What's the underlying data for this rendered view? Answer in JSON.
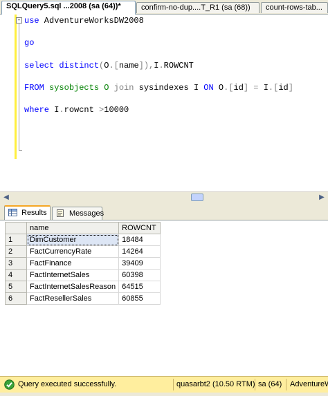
{
  "doc_tabs": [
    {
      "label": "SQLQuery5.sql ...2008 (sa (64))*",
      "active": true
    },
    {
      "label": "confirm-no-dup....T_R1 (sa (68))",
      "active": false
    },
    {
      "label": "count-rows-tab...",
      "active": false
    }
  ],
  "editor": {
    "lines": {
      "use": {
        "kw": "use",
        "rest": " AdventureWorksDW2008"
      },
      "go": {
        "kw": "go"
      },
      "select": {
        "kw1": "select",
        "sp1": " ",
        "kw2": "distinct",
        "p1": "(",
        "c1": "O",
        "p2": ".[",
        "c2": "name",
        "p3": "]),",
        "c3": "I",
        "p4": ".",
        "c4": "ROWCNT"
      },
      "from": {
        "kw1": "FROM",
        "t1": " sysobjects O ",
        "kw2": "join",
        "t2": " sysindexes I ",
        "kw3": "ON",
        "t3": " O",
        "p1": ".[",
        "c1": "id",
        "p2": "]",
        "eq": " = ",
        "c2": "I",
        "p3": ".[",
        "c3": "id",
        "p4": "]"
      },
      "where": {
        "kw": "where",
        "t1": " I",
        "p1": ".",
        "c1": "rowcnt ",
        "gt": ">",
        "c2": "10000"
      }
    },
    "outline_collapse_glyph": "-"
  },
  "results_tabs": [
    {
      "label": "Results",
      "icon": "grid-icon",
      "active": true
    },
    {
      "label": "Messages",
      "icon": "messages-icon",
      "active": false
    }
  ],
  "grid": {
    "columns": [
      "name",
      "ROWCNT"
    ],
    "rows": [
      {
        "n": "1",
        "name": "DimCustomer",
        "rowcnt": "18484"
      },
      {
        "n": "2",
        "name": "FactCurrencyRate",
        "rowcnt": "14264"
      },
      {
        "n": "3",
        "name": "FactFinance",
        "rowcnt": "39409"
      },
      {
        "n": "4",
        "name": "FactInternetSales",
        "rowcnt": "60398"
      },
      {
        "n": "5",
        "name": "FactInternetSalesReason",
        "rowcnt": "64515"
      },
      {
        "n": "6",
        "name": "FactResellerSales",
        "rowcnt": "60855"
      }
    ]
  },
  "status": {
    "message": "Query executed successfully.",
    "server": "quasarbt2 (10.50 RTM)",
    "user": "sa (64)",
    "database": "AdventureWo",
    "icon": "success-check-icon",
    "accent": "#ffee9e"
  },
  "colors": {
    "keyword": "#0000ff",
    "function": "#ff00ff",
    "operator": "#808080",
    "margin": "#ffef3f"
  }
}
